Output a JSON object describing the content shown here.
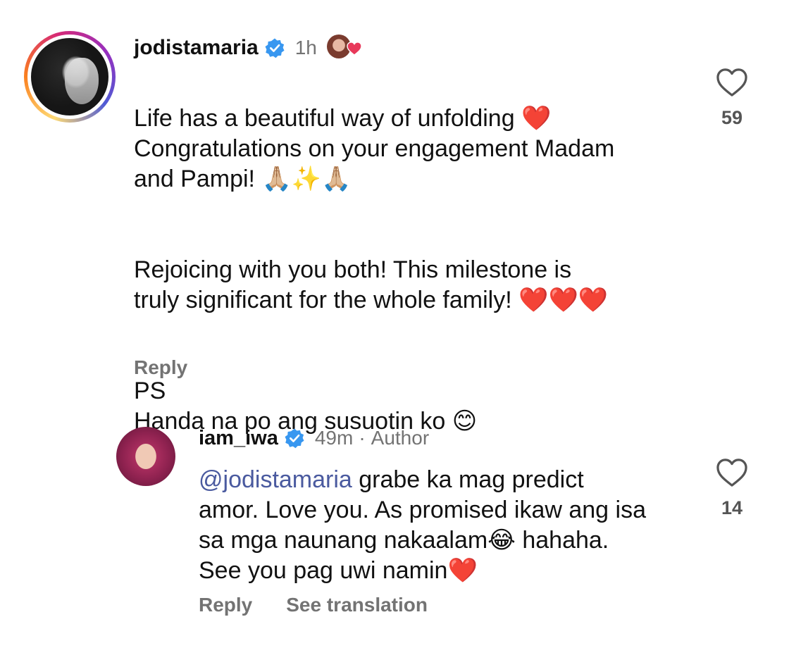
{
  "comment": {
    "username": "jodistamaria",
    "time": "1h",
    "lines": {
      "p1": "Life has a beautiful way of unfolding ❤️\nCongratulations on your engagement Madam\nand Pampi! 🙏🏼✨🙏🏼",
      "p2": "Rejoicing with you both! This milestone is\ntruly significant for the whole family! ❤️❤️❤️",
      "p3": "PS\nHanda na po ang susuotin ko 😊"
    },
    "reply_label": "Reply",
    "like_count": "59"
  },
  "reply": {
    "username": "iam_iwa",
    "time": "49m",
    "separator": "·",
    "author_tag": "Author",
    "mention": "@jodistamaria",
    "text": " grabe ka mag predict amor. Love you. As promised ikaw ang isa sa mga naunang nakaalam😂 hahaha. See you pag uwi namin❤️",
    "reply_label": "Reply",
    "translate_label": "See translation",
    "like_count": "14"
  },
  "colors": {
    "verified_blue": "#3897f0",
    "secondary_text": "#737373",
    "mention": "#4a5a9f",
    "heart_red": "#e8395a"
  },
  "icons": [
    "verified-badge-icon",
    "heart-outline-icon",
    "mini-heart-icon"
  ]
}
